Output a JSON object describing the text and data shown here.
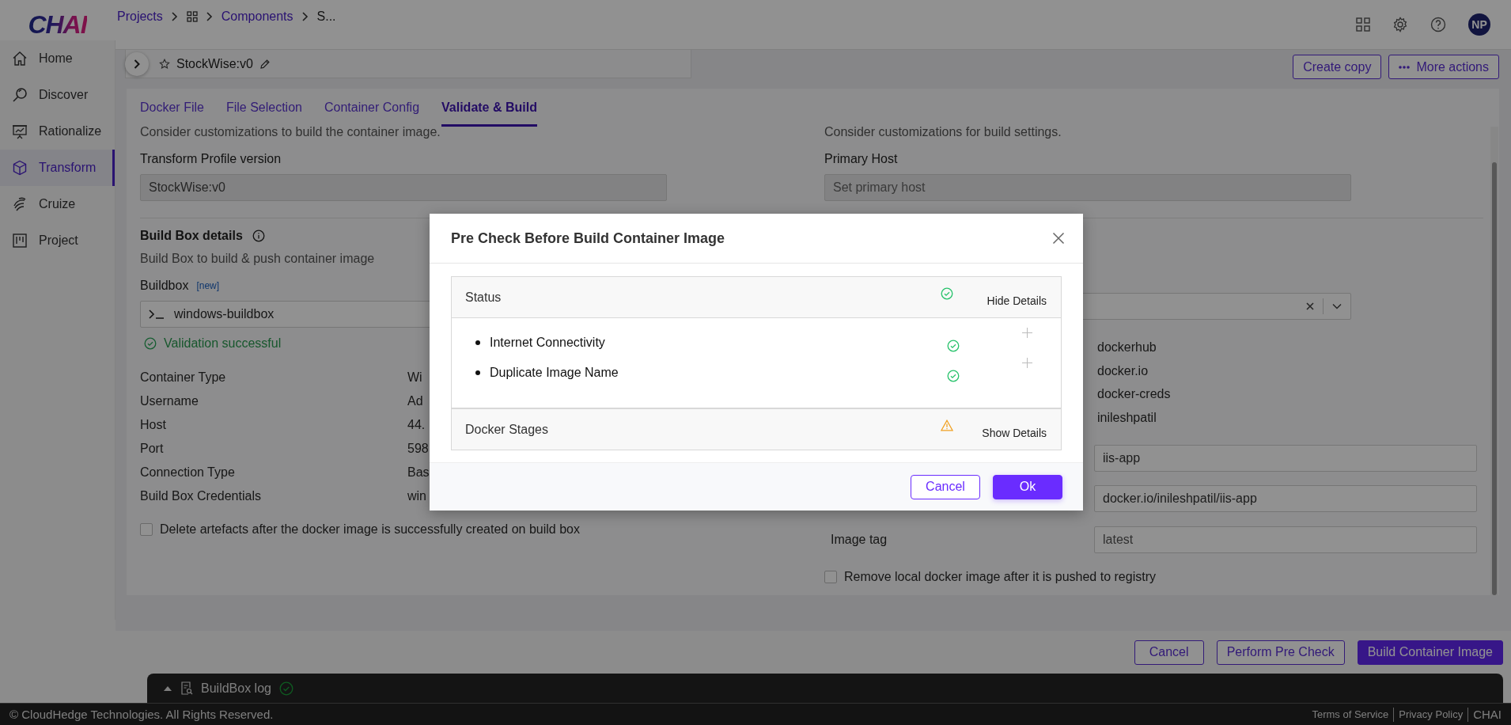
{
  "app": {
    "logo": "CHAI",
    "avatar": "NP"
  },
  "breadcrumb": [
    {
      "kind": "link",
      "label": "Projects"
    },
    {
      "kind": "grid"
    },
    {
      "kind": "link",
      "label": "Components"
    },
    {
      "kind": "text",
      "label": "S..."
    }
  ],
  "sidebar": [
    {
      "kind": "home",
      "label": "Home",
      "selected": false
    },
    {
      "kind": "discover",
      "label": "Discover",
      "selected": false
    },
    {
      "kind": "board",
      "label": "Rationalize",
      "selected": false
    },
    {
      "kind": "cube",
      "label": "Transform",
      "selected": true
    },
    {
      "kind": "cruize",
      "label": "Cruize",
      "selected": false
    },
    {
      "kind": "kanban",
      "label": "Project",
      "selected": false
    }
  ],
  "header": {
    "title": "StockWise:v0",
    "actions": [
      {
        "label": "Create copy",
        "kind": "plain"
      },
      {
        "label": "More actions",
        "kind": "dots"
      }
    ]
  },
  "tabs": [
    {
      "label": "Docker File",
      "selected": false
    },
    {
      "label": "File Selection",
      "selected": false
    },
    {
      "label": "Container Config",
      "selected": false
    },
    {
      "label": "Validate & Build",
      "selected": true
    }
  ],
  "left": {
    "description": "Consider customizations to build the container image.",
    "profile_label": "Transform Profile version",
    "profile_field": {
      "value": "StockWise:v0",
      "disabled": true
    },
    "section_title": "Build Box details",
    "section_subtitle": "Build Box to build & push container image",
    "buildbox_label": "Buildbox",
    "new_tag": "[new]",
    "buildbox_value": "windows-buildbox",
    "validation": "Validation successful",
    "details": [
      {
        "label": "Container Type",
        "value": "Wi"
      },
      {
        "label": "Username",
        "value": "Ad"
      },
      {
        "label": "Host",
        "value": "44."
      },
      {
        "label": "Port",
        "value": "598"
      },
      {
        "label": "Connection Type",
        "value": "Bas"
      },
      {
        "label": "Build Box Credentials",
        "value": "win"
      }
    ],
    "checkbox": {
      "label": "Delete artefacts after the docker image is successfully created on build box",
      "checked": false
    }
  },
  "right": {
    "description": "Consider customizations for build settings.",
    "host_label": "Primary Host",
    "host_field": {
      "placeholder": "Set primary host",
      "disabled": true
    },
    "registry_values": [
      "dockerhub",
      "docker.io",
      "docker-creds",
      "inileshpatil"
    ],
    "fields": [
      {
        "value": "iis-app"
      },
      {
        "value": "docker.io/inileshpatil/iis-app"
      }
    ],
    "image_tag": {
      "label": "Image tag",
      "value": "latest"
    },
    "checkbox": {
      "label": "Remove local docker image after it is pushed to registry",
      "checked": false
    }
  },
  "actions": [
    {
      "label": "Cancel",
      "kind": "secondary"
    },
    {
      "label": "Perform Pre Check",
      "kind": "secondary"
    },
    {
      "label": "Build Container Image",
      "kind": "primary"
    }
  ],
  "log": {
    "label": "BuildBox log",
    "kind": "success"
  },
  "footer": {
    "copyright": "© CloudHedge Technologies. All Rights Reserved.",
    "links": [
      "Terms of Service",
      "Privacy Policy",
      "CHAI"
    ]
  },
  "modal": {
    "title": "Pre Check Before Build Container Image",
    "sections": [
      {
        "title": "Status",
        "kind": "success",
        "toggle": "Hide Details",
        "expanded": true,
        "items": [
          {
            "label": "Internet Connectivity",
            "kind": "success"
          },
          {
            "label": "Duplicate Image Name",
            "kind": "success"
          }
        ]
      },
      {
        "title": "Docker Stages",
        "kind": "warning",
        "toggle": "Show Details",
        "expanded": false
      }
    ],
    "buttons": [
      {
        "label": "Cancel",
        "kind": "secondary"
      },
      {
        "label": "Ok",
        "kind": "primary"
      }
    ]
  }
}
